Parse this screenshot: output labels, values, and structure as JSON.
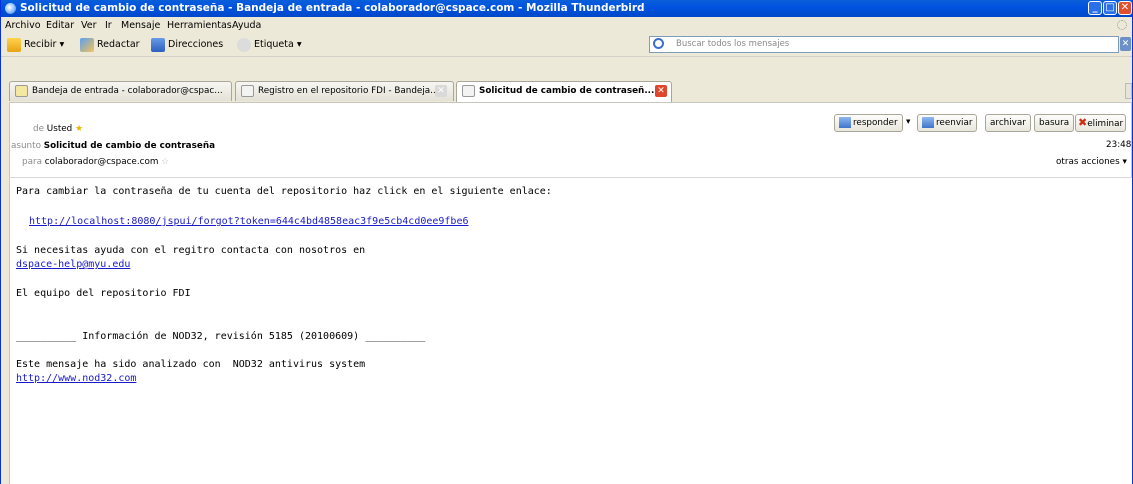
{
  "window": {
    "title": "Solicitud de cambio de contraseña - Bandeja de entrada - colaborador@cspace.com - Mozilla Thunderbird"
  },
  "menu": [
    "Archivo",
    "Editar",
    "Ver",
    "Ir",
    "Mensaje",
    "Herramientas",
    "Ayuda"
  ],
  "toolbar": {
    "get_label": "Recibir",
    "write_label": "Redactar",
    "address_label": "Direcciones",
    "tag_label": "Etiqueta",
    "search_placeholder": "Buscar todos los mensajes"
  },
  "tabs": [
    {
      "label": "Bandeja de entrada - colaborador@cspac..."
    },
    {
      "label": "Registro en el repositorio FDI - Bandeja..."
    },
    {
      "label": "Solicitud de cambio de contraseñ..."
    }
  ],
  "header": {
    "from_label": "de",
    "from_value": "Usted",
    "subject_label": "asunto",
    "subject_value": "Solicitud de cambio de contraseña",
    "to_label": "para",
    "to_value": "colaborador@cspace.com",
    "time": "23:48",
    "other_actions": "otras acciones",
    "buttons": {
      "reply": "responder",
      "forward": "reenviar",
      "archive": "archivar",
      "junk": "basura",
      "delete": "eliminar"
    }
  },
  "body": {
    "line1": "Para cambiar la contraseña de tu cuenta del repositorio haz click en el siguiente enlace:",
    "reset_link": "http://localhost:8080/jspui/forgot?token=644c4bd4858eac3f9e5cb4cd0ee9fbe6",
    "help_line": "Si necesitas ayuda con el regitro contacta con nosotros en",
    "help_email": "dspace-help@myu.edu",
    "signature": "El equipo del repositorio FDI",
    "nod_line": "__________ Información de NOD32, revisión 5185 (20100609) __________",
    "nod_analyzed": "Este mensaje ha sido analizado con  NOD32 antivirus system",
    "nod_link": "http://www.nod32.com"
  },
  "colors": {
    "titlebar": "#0053e0",
    "link": "#1a1ac8",
    "chrome": "#ece9d8"
  }
}
